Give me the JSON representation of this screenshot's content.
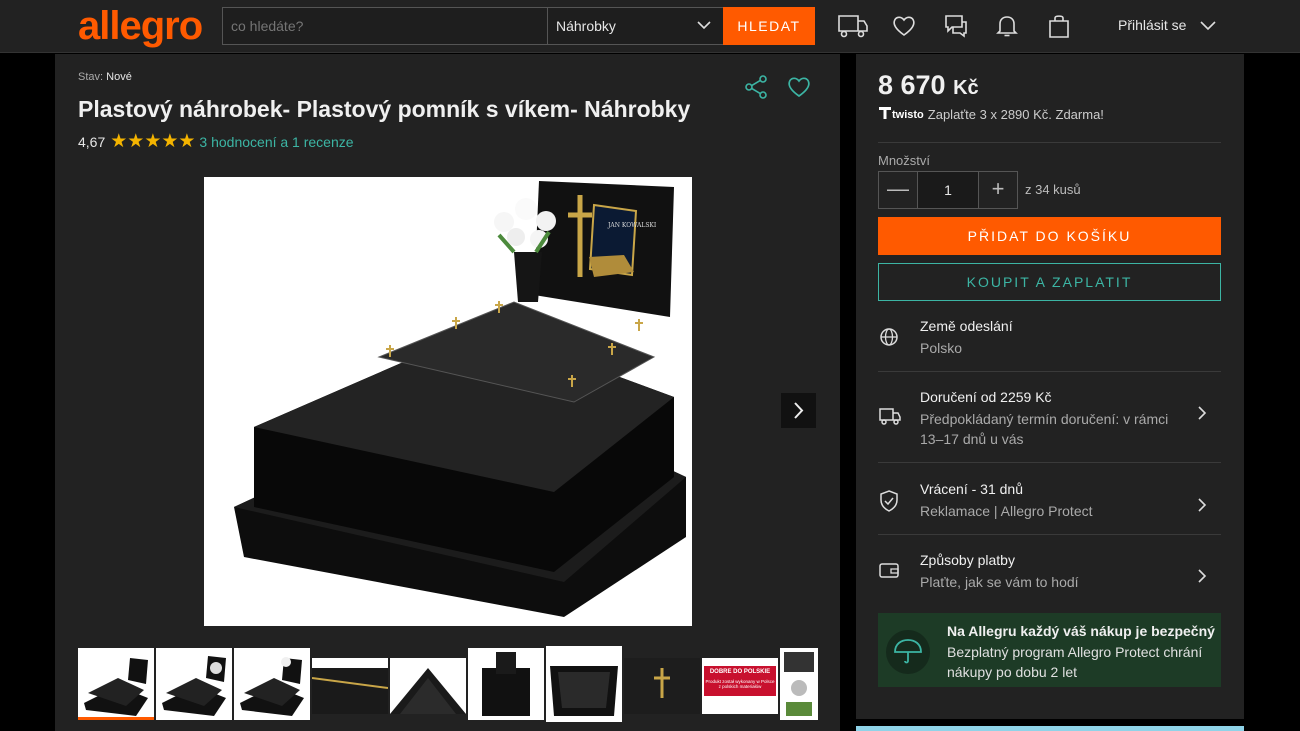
{
  "header": {
    "logo": "allegro",
    "search_placeholder": "co hledáte?",
    "category": "Náhrobky",
    "search_button": "HLEDAT",
    "login": "Přihlásit se"
  },
  "product": {
    "condition_label": "Stav:",
    "condition_value": "Nové",
    "title": "Plastový náhrobek- Plastový pomník s víkem- Náhrobky",
    "rating_value": "4,67",
    "stars": "★★★★★",
    "reviews_link": "3 hodnocení a 1 recenze",
    "plaque_name": "JAN\nKOWALSKI",
    "thumb_text": "DOBRE DO POLSKIE",
    "thumb_subtext": "Produkt został wykonany w Polsce z polskich materiałów"
  },
  "buy": {
    "price": "8 670",
    "currency": "Kč",
    "twisto_logo": "twisto",
    "twisto_text": "Zaplaťte 3 x 2890 Kč. Zdarma!",
    "quantity_label": "Množství",
    "quantity_value": "1",
    "quantity_minus": "—",
    "quantity_plus": "+",
    "quantity_of": "z 34 kusů",
    "add_to_cart": "PŘIDAT DO KOŠÍKU",
    "buy_now": "KOUPIT A ZAPLATIT"
  },
  "info": [
    {
      "title": "Země odeslání",
      "sub": "Polsko"
    },
    {
      "title": "Doručení od 2259 Kč",
      "sub": "Předpokládaný termín doručení: v rámci 13–17 dnů u vás"
    },
    {
      "title": "Vrácení - 31 dnů",
      "sub": "Reklamace | Allegro Protect"
    },
    {
      "title": "Způsoby platby",
      "sub": "Plaťte, jak se vám to hodí"
    }
  ],
  "protect": {
    "title": "Na Allegru každý váš nákup je bezpečný",
    "sub": "Bezplatný program Allegro Protect chrání nákupy po dobu 2 let"
  },
  "colors": {
    "accent": "#ff5a00",
    "teal": "#3cb5a4",
    "star": "#f4b400"
  }
}
